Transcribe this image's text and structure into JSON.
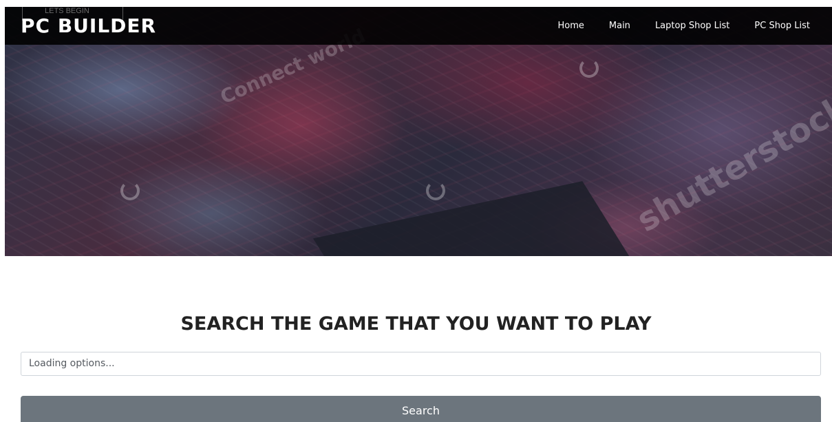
{
  "brand": {
    "title": "PC BUILDER",
    "top_tag": "LETS BEGIN"
  },
  "nav": {
    "items": [
      {
        "label": "Home"
      },
      {
        "label": "Main"
      },
      {
        "label": "Laptop Shop List"
      },
      {
        "label": "PC Shop List"
      }
    ]
  },
  "hero": {
    "watermark_1": "Connect world",
    "watermark_2": "shutterstock",
    "colors": {
      "navbar_bg": "#000000",
      "accent_red": "#8c2846",
      "dark_chip": "#1c1f29"
    }
  },
  "search": {
    "heading": "SEARCH THE GAME THAT YOU WANT TO PLAY",
    "select_placeholder": "Loading options...",
    "button_label": "Search",
    "button_color": "#6c757d"
  }
}
